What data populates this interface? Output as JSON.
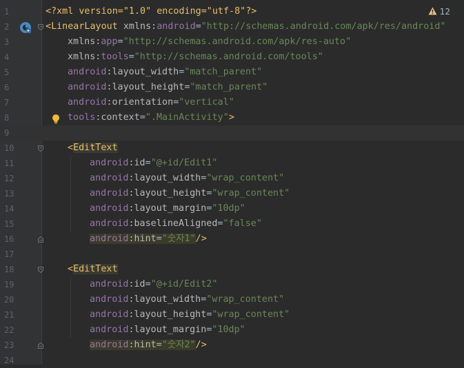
{
  "editor": {
    "warnings_count": "12",
    "lines": [
      {
        "n": "1",
        "parts": [
          {
            "t": "<?xml version=\"1.0\" encoding=\"utf-8\"?>",
            "c": "pi"
          }
        ]
      },
      {
        "n": "2",
        "parts": [
          {
            "t": "<",
            "c": "lt"
          },
          {
            "t": "LinearLayout",
            "c": "tag"
          },
          {
            "t": " xmlns:",
            "c": "attr"
          },
          {
            "t": "android",
            "c": "ns"
          },
          {
            "t": "=",
            "c": "eq"
          },
          {
            "t": "\"http://schemas.android.com/apk/res/android\"",
            "c": "val"
          }
        ]
      },
      {
        "n": "3",
        "parts": [
          {
            "t": "xmlns:",
            "c": "attr"
          },
          {
            "t": "app",
            "c": "ns"
          },
          {
            "t": "=",
            "c": "eq"
          },
          {
            "t": "\"http://schemas.android.com/apk/res-auto\"",
            "c": "val"
          }
        ]
      },
      {
        "n": "4",
        "parts": [
          {
            "t": "xmlns:",
            "c": "attr"
          },
          {
            "t": "tools",
            "c": "ns"
          },
          {
            "t": "=",
            "c": "eq"
          },
          {
            "t": "\"http://schemas.android.com/tools\"",
            "c": "val"
          }
        ]
      },
      {
        "n": "5",
        "parts": [
          {
            "t": "android",
            "c": "ns"
          },
          {
            "t": ":layout_width",
            "c": "attr"
          },
          {
            "t": "=",
            "c": "eq"
          },
          {
            "t": "\"match_parent\"",
            "c": "val"
          }
        ]
      },
      {
        "n": "6",
        "parts": [
          {
            "t": "android",
            "c": "ns"
          },
          {
            "t": ":layout_height",
            "c": "attr"
          },
          {
            "t": "=",
            "c": "eq"
          },
          {
            "t": "\"match_parent\"",
            "c": "val"
          }
        ]
      },
      {
        "n": "7",
        "parts": [
          {
            "t": "android",
            "c": "ns"
          },
          {
            "t": ":orientation",
            "c": "attr"
          },
          {
            "t": "=",
            "c": "eq"
          },
          {
            "t": "\"vertical\"",
            "c": "val"
          }
        ]
      },
      {
        "n": "8",
        "parts": [
          {
            "t": "tools",
            "c": "ns"
          },
          {
            "t": ":context",
            "c": "attr"
          },
          {
            "t": "=",
            "c": "eq"
          },
          {
            "t": "\".MainActivity\"",
            "c": "val"
          },
          {
            "t": ">",
            "c": "lt"
          }
        ]
      },
      {
        "n": "9",
        "parts": []
      },
      {
        "n": "10",
        "parts": [
          {
            "t": "<",
            "c": "lt"
          },
          {
            "t": "EditText",
            "c": "tag",
            "hl": true
          }
        ]
      },
      {
        "n": "11",
        "parts": [
          {
            "t": "android",
            "c": "ns"
          },
          {
            "t": ":id",
            "c": "attr"
          },
          {
            "t": "=",
            "c": "eq"
          },
          {
            "t": "\"@+id/Edit1\"",
            "c": "val"
          }
        ]
      },
      {
        "n": "12",
        "parts": [
          {
            "t": "android",
            "c": "ns"
          },
          {
            "t": ":layout_width",
            "c": "attr"
          },
          {
            "t": "=",
            "c": "eq"
          },
          {
            "t": "\"wrap_content\"",
            "c": "val"
          }
        ]
      },
      {
        "n": "13",
        "parts": [
          {
            "t": "android",
            "c": "ns"
          },
          {
            "t": ":layout_height",
            "c": "attr"
          },
          {
            "t": "=",
            "c": "eq"
          },
          {
            "t": "\"wrap_content\"",
            "c": "val"
          }
        ]
      },
      {
        "n": "14",
        "parts": [
          {
            "t": "android",
            "c": "ns"
          },
          {
            "t": ":layout_margin",
            "c": "attr"
          },
          {
            "t": "=",
            "c": "eq"
          },
          {
            "t": "\"10dp\"",
            "c": "val"
          }
        ]
      },
      {
        "n": "15",
        "parts": [
          {
            "t": "android",
            "c": "ns"
          },
          {
            "t": ":baselineAligned",
            "c": "attr"
          },
          {
            "t": "=",
            "c": "eq"
          },
          {
            "t": "\"false\"",
            "c": "val"
          }
        ]
      },
      {
        "n": "16",
        "parts": [
          {
            "t": "android",
            "c": "ns",
            "hl": true
          },
          {
            "t": ":hint",
            "c": "attr",
            "hl": true
          },
          {
            "t": "=",
            "c": "eq",
            "hl": true
          },
          {
            "t": "\"숫자1\"",
            "c": "val",
            "hl": true
          },
          {
            "t": "/>",
            "c": "lt"
          }
        ]
      },
      {
        "n": "17",
        "parts": []
      },
      {
        "n": "18",
        "parts": [
          {
            "t": "<",
            "c": "lt"
          },
          {
            "t": "EditText",
            "c": "tag",
            "hl": true
          }
        ]
      },
      {
        "n": "19",
        "parts": [
          {
            "t": "android",
            "c": "ns"
          },
          {
            "t": ":id",
            "c": "attr"
          },
          {
            "t": "=",
            "c": "eq"
          },
          {
            "t": "\"@+id/Edit2\"",
            "c": "val"
          }
        ]
      },
      {
        "n": "20",
        "parts": [
          {
            "t": "android",
            "c": "ns"
          },
          {
            "t": ":layout_width",
            "c": "attr"
          },
          {
            "t": "=",
            "c": "eq"
          },
          {
            "t": "\"wrap_content\"",
            "c": "val"
          }
        ]
      },
      {
        "n": "21",
        "parts": [
          {
            "t": "android",
            "c": "ns"
          },
          {
            "t": ":layout_height",
            "c": "attr"
          },
          {
            "t": "=",
            "c": "eq"
          },
          {
            "t": "\"wrap_content\"",
            "c": "val"
          }
        ]
      },
      {
        "n": "22",
        "parts": [
          {
            "t": "android",
            "c": "ns"
          },
          {
            "t": ":layout_margin",
            "c": "attr"
          },
          {
            "t": "=",
            "c": "eq"
          },
          {
            "t": "\"10dp\"",
            "c": "val"
          }
        ]
      },
      {
        "n": "23",
        "parts": [
          {
            "t": "android",
            "c": "ns",
            "hl": true
          },
          {
            "t": ":hint",
            "c": "attr",
            "hl": true
          },
          {
            "t": "=",
            "c": "eq",
            "hl": true
          },
          {
            "t": "\"숫자2\"",
            "c": "val",
            "hl": true
          },
          {
            "t": "/>",
            "c": "lt"
          }
        ]
      },
      {
        "n": "24",
        "parts": []
      }
    ]
  },
  "icons": {
    "warning": "warning-triangle-icon",
    "gutter_activity": "activity-layout-icon",
    "intention_bulb": "lightbulb-icon",
    "fold": "fold-marker-icon"
  },
  "colors": {
    "background": "#2b2b2b",
    "gutter": "#313335",
    "tag": "#e8bf6a",
    "namespace": "#9876aa",
    "value": "#6a8759",
    "warning": "#e5c07b"
  }
}
